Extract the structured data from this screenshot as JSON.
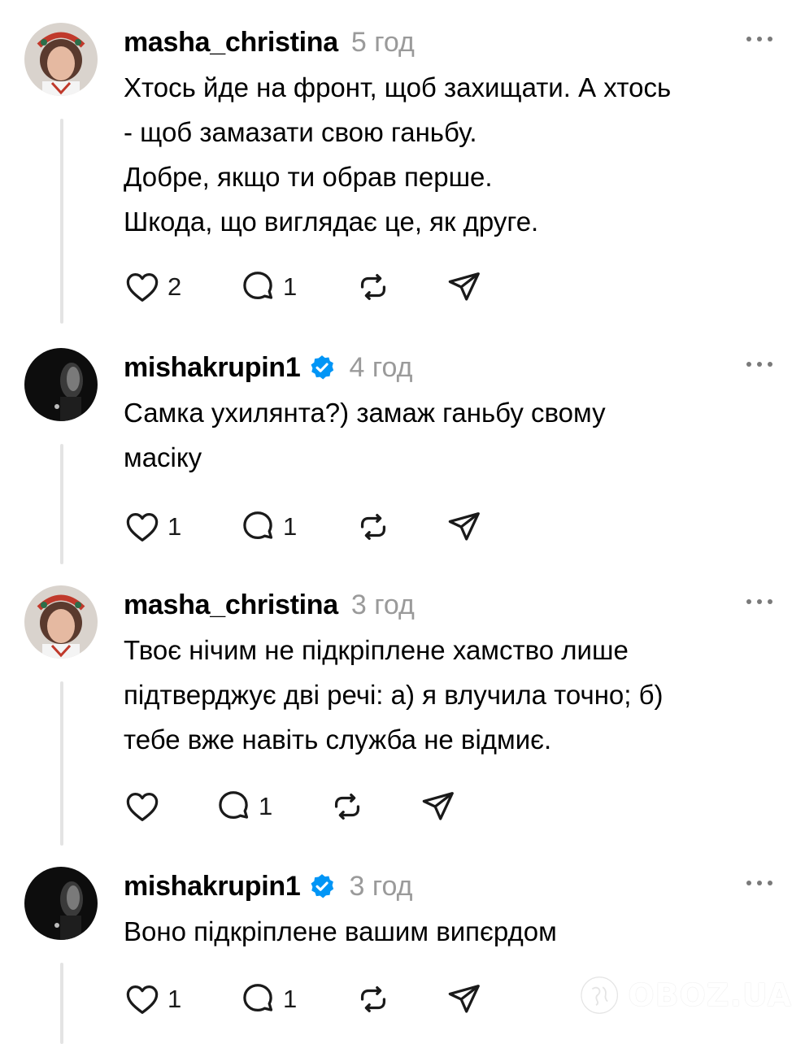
{
  "posts": [
    {
      "username": "masha_christina",
      "verified": false,
      "time": "5 год",
      "lines": [
        "Хтось йде на фронт, щоб захищати. А хтось",
        "- щоб замазати свою ганьбу.",
        "Добре, якщо ти обрав перше.",
        "Шкода, що виглядає це, як друге."
      ],
      "likes": "2",
      "replies": "1"
    },
    {
      "username": "mishakrupin1",
      "verified": true,
      "time": "4 год",
      "lines": [
        "Самка ухилянта?) замаж ганьбу свому",
        "масіку"
      ],
      "likes": "1",
      "replies": "1"
    },
    {
      "username": "masha_christina",
      "verified": false,
      "time": "3 год",
      "lines": [
        "Твоє нічим не підкріплене хамство лише",
        "підтверджує дві речі: а) я влучила точно; б)",
        "тебе вже навіть служба не відмиє."
      ],
      "likes": "",
      "replies": "1"
    },
    {
      "username": "mishakrupin1",
      "verified": true,
      "time": "3 год",
      "lines": [
        "Воно підкріплене вашим випєрдом"
      ],
      "likes": "1",
      "replies": "1"
    }
  ],
  "watermark": "OBOZ.UA",
  "colors": {
    "text": "#000000",
    "muted": "#9a9a9a",
    "verified": "#0095f6",
    "thread_line": "#e4e4e4"
  },
  "icons": [
    "heart-icon",
    "comment-icon",
    "repost-icon",
    "share-icon",
    "more-icon",
    "verified-icon"
  ]
}
